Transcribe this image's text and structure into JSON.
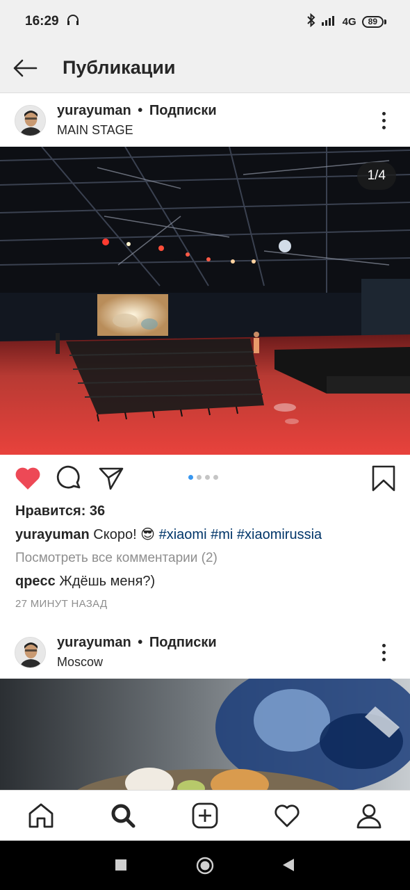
{
  "status_bar": {
    "time": "16:29",
    "network": "4G",
    "battery": "89",
    "headphones_icon": "headphones-icon",
    "bluetooth_icon": "bluetooth-icon",
    "signal_icon": "signal-icon"
  },
  "header": {
    "back_icon": "arrow-left-icon",
    "title": "Публикации"
  },
  "posts": [
    {
      "username": "yurayuman",
      "separator": "•",
      "follow_label": "Подписки",
      "location": "MAIN STAGE",
      "counter": "1/4",
      "likes": "Нравится: 36",
      "caption_user": "yurayuman",
      "caption_text": "Скоро! 😎",
      "hashtags": [
        "#xiaomi",
        "#mi",
        "#xiaomirussia"
      ],
      "view_comments": "Посмотреть все комментарии (2)",
      "comment_user": "qpecc",
      "comment_text": "Ждёшь меня?)",
      "timestamp": "27 МИНУТ НАЗАД",
      "carousel": {
        "current": 1,
        "total": 4
      },
      "liked": true
    },
    {
      "username": "yurayuman",
      "separator": "•",
      "follow_label": "Подписки",
      "location": "Moscow"
    }
  ],
  "bottom_nav": [
    "home-icon",
    "search-icon",
    "add-post-icon",
    "heart-icon",
    "profile-icon"
  ],
  "system_nav": [
    "recents-icon",
    "home-circle-icon",
    "back-triangle-icon"
  ],
  "colors": {
    "like_red": "#ed4956",
    "hashtag_blue": "#003569",
    "dot_active": "#3897f0",
    "muted": "#8e8e8e"
  }
}
